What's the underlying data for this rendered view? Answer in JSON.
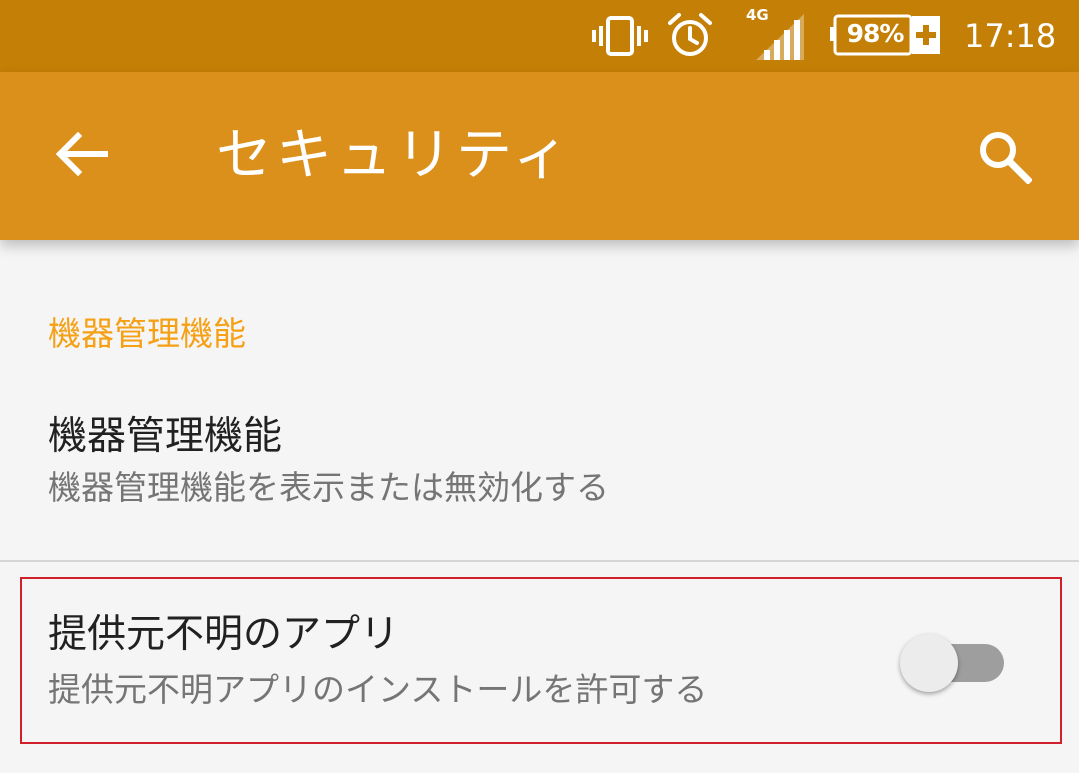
{
  "status_bar": {
    "network_type": "4G",
    "battery_level": "98%",
    "time": "17:18",
    "icons": [
      "vibrate-icon",
      "alarm-icon",
      "signal-icon",
      "battery-charging-icon"
    ]
  },
  "app_bar": {
    "title": "セキュリティ",
    "back_icon": "arrow-back-icon",
    "search_icon": "search-icon"
  },
  "section": {
    "header": "機器管理機能"
  },
  "items": [
    {
      "title": "機器管理機能",
      "summary": "機器管理機能を表示または無効化する"
    },
    {
      "title": "提供元不明のアプリ",
      "summary": "提供元不明アプリのインストールを許可する",
      "toggle_on": false
    }
  ],
  "colors": {
    "status_bar": "#c47f06",
    "app_bar": "#da901b",
    "accent": "#f5a015",
    "highlight": "#d0202c"
  }
}
